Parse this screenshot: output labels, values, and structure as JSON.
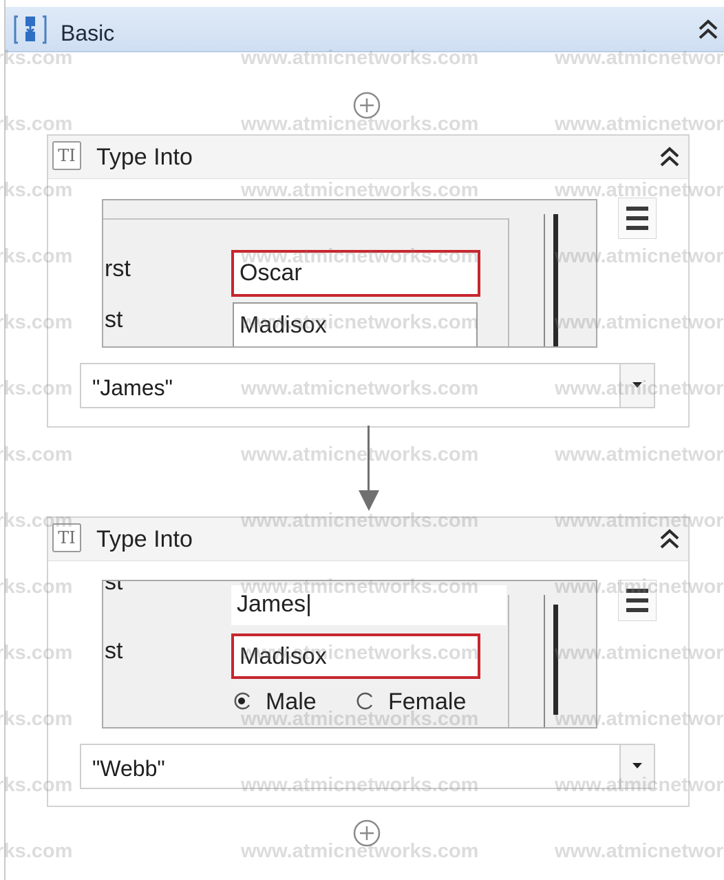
{
  "sequence": {
    "title": "Basic",
    "icon": "sequence-icon",
    "collapse_icon": "double-chevron-up-icon"
  },
  "add_icon": "plus-circle-icon",
  "activities": [
    {
      "title": "Type Into",
      "icon_text": "TI",
      "text_value": "\"James\"",
      "preview": {
        "label_1": "rst",
        "label_2": "st",
        "highlighted_value": "Oscar",
        "other_value": "Madisox"
      }
    },
    {
      "title": "Type Into",
      "icon_text": "TI",
      "text_value": "\"Webb\"",
      "preview": {
        "label_1": "st",
        "label_2": "st",
        "other_value": "James|",
        "highlighted_value": "Madisox",
        "radio_male": "Male",
        "radio_female": "Female"
      }
    }
  ],
  "watermark": "www.atmicnetworks.com",
  "colors": {
    "header_bg": "#d6e4f4",
    "highlight_border": "#c8262e",
    "connector": "#707070"
  }
}
